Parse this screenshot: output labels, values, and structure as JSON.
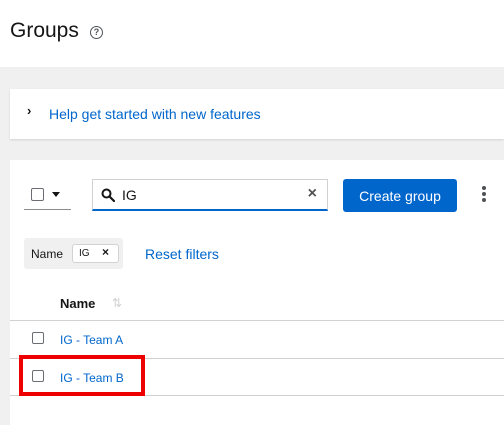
{
  "header": {
    "title": "Groups",
    "help_icon": "?"
  },
  "banner": {
    "text": "Help get started with new features",
    "chevron": "›"
  },
  "toolbar": {
    "search": {
      "value": "IG",
      "clear_icon": "×"
    },
    "create_label": "Create group"
  },
  "filters": {
    "chip_group_label": "Name",
    "chips": [
      {
        "label": "IG",
        "close": "×"
      }
    ],
    "reset_label": "Reset filters"
  },
  "table": {
    "columns": [
      {
        "label": "Name",
        "sort_icon": "⇅"
      }
    ],
    "rows": [
      {
        "name": "IG - Team A"
      },
      {
        "name": "IG - Team B"
      }
    ]
  },
  "colors": {
    "primary": "#0066cc",
    "highlight": "#ee0000"
  }
}
